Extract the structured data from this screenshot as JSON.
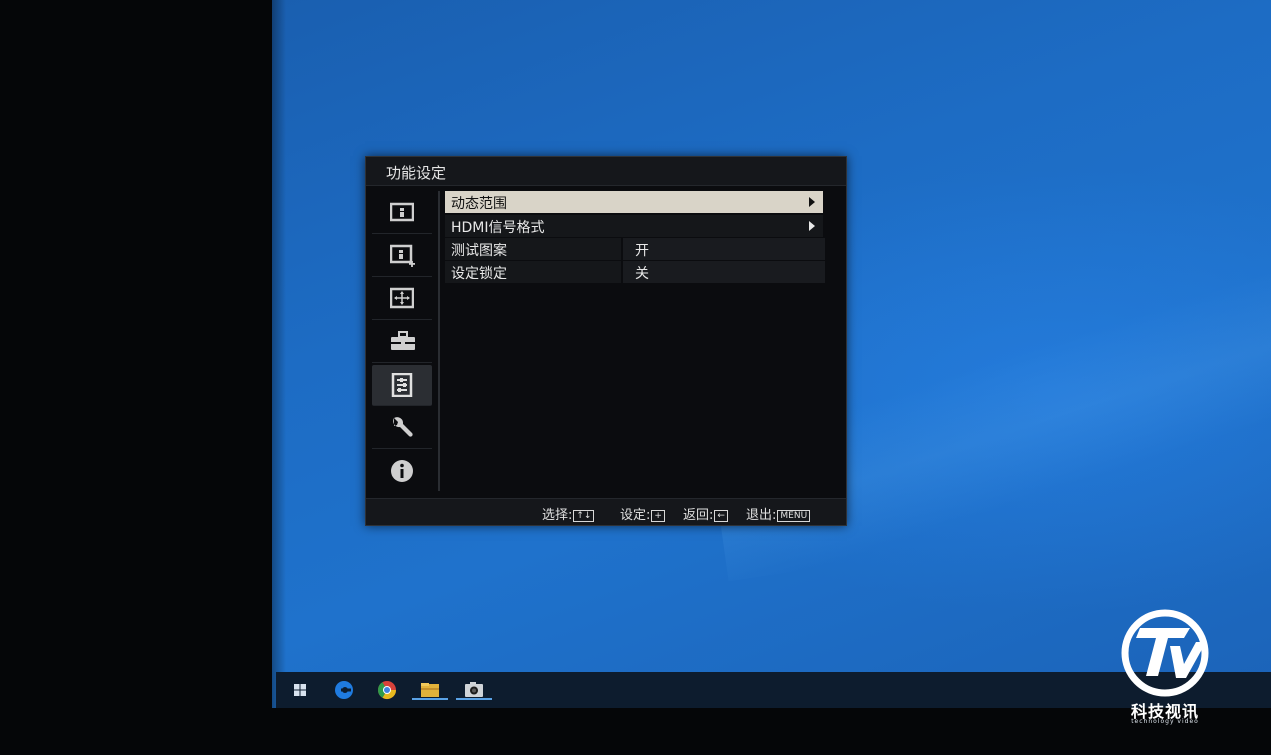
{
  "osd": {
    "title": "功能设定",
    "sidebar": [
      {
        "icon": "picture-icon",
        "active": false
      },
      {
        "icon": "picture-plus-icon",
        "active": false
      },
      {
        "icon": "screen-position-icon",
        "active": false
      },
      {
        "icon": "toolbox-icon",
        "active": false
      },
      {
        "icon": "function-settings-icon",
        "active": true
      },
      {
        "icon": "wrench-icon",
        "active": false
      },
      {
        "icon": "info-icon",
        "active": false
      }
    ],
    "items": [
      {
        "label": "动态范围",
        "value": "",
        "submenu": true,
        "selected": true
      },
      {
        "label": "HDMI信号格式",
        "value": "",
        "submenu": true,
        "selected": false
      },
      {
        "label": "测试图案",
        "value": "开",
        "submenu": false,
        "selected": false
      },
      {
        "label": "设定锁定",
        "value": "关",
        "submenu": false,
        "selected": false
      }
    ],
    "footer": {
      "select_label": "选择:",
      "select_keys": "↑↓",
      "set_label": "设定:",
      "set_key": "+",
      "back_label": "返回:",
      "back_key": "←",
      "exit_label": "退出:",
      "exit_key": "MENU"
    }
  },
  "taskbar": {
    "icons": [
      "windows-start-icon",
      "edge-browser-icon",
      "chrome-browser-icon",
      "file-explorer-icon",
      "camera-app-icon"
    ]
  },
  "watermark": {
    "logo": "tv-logo",
    "text": "科技视讯",
    "subtitle": "technology video"
  },
  "colors": {
    "desktop": "#1d6cc4",
    "osd_bg": "#0b0c0f",
    "selected_row": "#d9d4c8",
    "taskbar": "#0d1c2e"
  }
}
